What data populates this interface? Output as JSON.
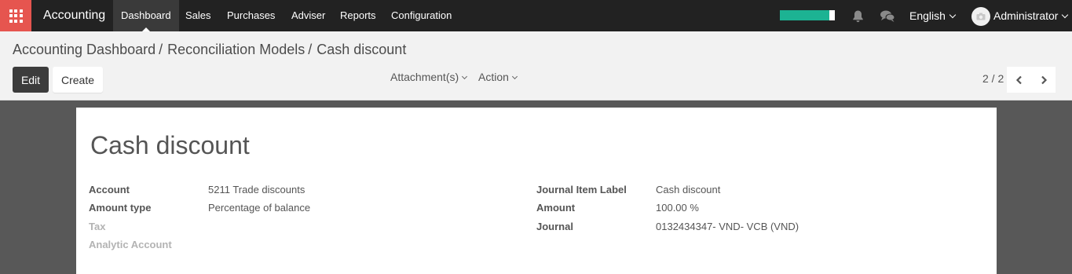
{
  "navbar": {
    "app_title": "Accounting",
    "menu": [
      "Dashboard",
      "Sales",
      "Purchases",
      "Adviser",
      "Reports",
      "Configuration"
    ],
    "language": "English",
    "user": "Administrator",
    "progress": 0.9,
    "progress_color": "#1cb393",
    "accent_color": "#e6554f"
  },
  "breadcrumb": {
    "items": [
      "Accounting Dashboard",
      "Reconciliation Models"
    ],
    "separator": "/",
    "current": "Cash discount"
  },
  "toolbar": {
    "edit_label": "Edit",
    "create_label": "Create",
    "attachments_label": "Attachment(s)",
    "action_label": "Action",
    "pager": "2 / 2"
  },
  "record": {
    "title": "Cash discount",
    "left_fields": [
      {
        "label": "Account",
        "value": "5211 Trade discounts"
      },
      {
        "label": "Amount type",
        "value": "Percentage of balance"
      },
      {
        "label": "Tax",
        "value": ""
      },
      {
        "label": "Analytic Account",
        "value": ""
      }
    ],
    "right_fields": [
      {
        "label": "Journal Item Label",
        "value": "Cash discount"
      },
      {
        "label": "Amount",
        "value": "100.00 %"
      },
      {
        "label": "Journal",
        "value": "0132434347- VND- VCB (VND)"
      }
    ]
  },
  "icons": [
    "apps-grid-icon",
    "bell-icon",
    "chat-icon",
    "chevron-down-icon",
    "chevron-left-icon",
    "chevron-right-icon",
    "avatar-camera-icon"
  ]
}
